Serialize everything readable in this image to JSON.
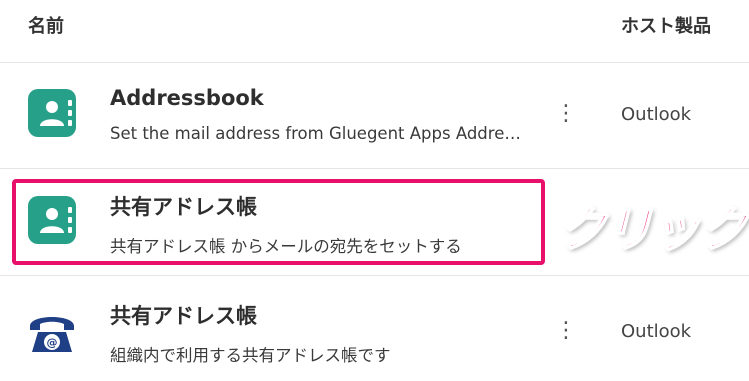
{
  "table": {
    "headers": {
      "name": "名前",
      "host": "ホスト製品"
    },
    "rows": [
      {
        "title": "Addressbook",
        "description": "Set the mail address from Gluegent Apps Addre…",
        "host": "Outlook",
        "icon": "addressbook-icon",
        "more_label": "⋮"
      },
      {
        "title": "共有アドレス帳",
        "description": "共有アドレス帳 からメールの宛先をセットする",
        "icon": "addressbook-icon"
      },
      {
        "title": "共有アドレス帳",
        "description": "組織内で利用する共有アドレス帳です",
        "host": "Outlook",
        "icon": "telephone-icon",
        "more_label": "⋮"
      }
    ]
  },
  "annotation": {
    "label": "クリック",
    "color": "#e8106a"
  },
  "colors": {
    "icon_teal": "#27a08a",
    "icon_navy": "#1f3f86"
  }
}
